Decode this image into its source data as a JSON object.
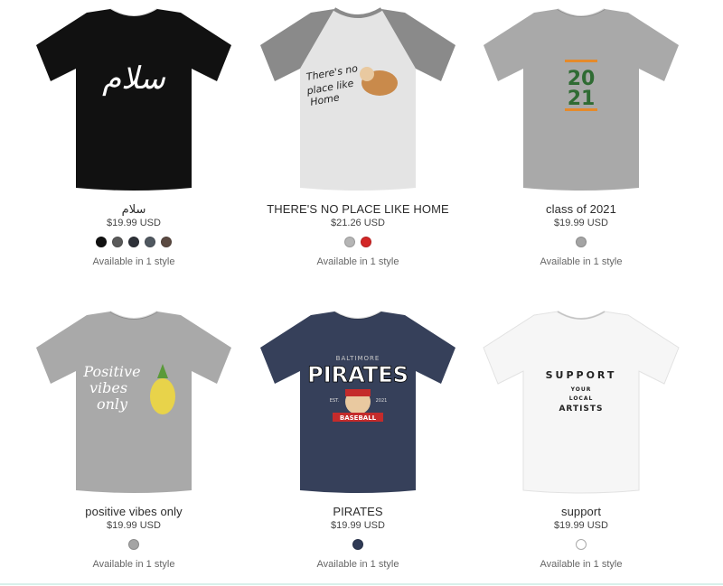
{
  "products": [
    {
      "title": "سلام",
      "price": "$19.99 USD",
      "availability": "Available in 1 style",
      "shirt_color": "#111111",
      "sleeve_color": "#111111",
      "swatches": [
        "#111111",
        "#5a5a5a",
        "#2e3138",
        "#505860",
        "#5b4a42"
      ],
      "print_text": [
        "سلام"
      ],
      "print_color": "#ffffff"
    },
    {
      "title": "THERE'S NO PLACE LIKE HOME",
      "price": "$21.26 USD",
      "availability": "Available in 1 style",
      "shirt_color": "#e4e4e4",
      "sleeve_color": "#8a8a8a",
      "swatches": [
        "#b5b5b5",
        "#d32626"
      ],
      "print_text": [
        "There's no",
        "place like",
        "Home"
      ],
      "print_color": "#222222"
    },
    {
      "title": "class of 2021",
      "price": "$19.99 USD",
      "availability": "Available in 1 style",
      "shirt_color": "#a9a9a9",
      "sleeve_color": "#a9a9a9",
      "swatches": [
        "#a4a4a4"
      ],
      "print_text": [
        "20",
        "21"
      ],
      "print_color": "#2f6b33"
    },
    {
      "title": "positive vibes only",
      "price": "$19.99 USD",
      "availability": "Available in 1 style",
      "shirt_color": "#a9a9a9",
      "sleeve_color": "#a9a9a9",
      "swatches": [
        "#a4a4a4"
      ],
      "print_text": [
        "Positive",
        "vibes",
        "only"
      ],
      "print_color": "#ffffff"
    },
    {
      "title": "PIRATES",
      "price": "$19.99 USD",
      "availability": "Available in 1 style",
      "shirt_color": "#36405a",
      "sleeve_color": "#36405a",
      "swatches": [
        "#2f3a55"
      ],
      "print_text": [
        "BALTIMORE",
        "PIRATES",
        "EST.",
        "2021",
        "BASEBALL"
      ],
      "print_color": "#ffffff"
    },
    {
      "title": "support",
      "price": "$19.99 USD",
      "availability": "Available in 1 style",
      "shirt_color": "#f6f6f6",
      "sleeve_color": "#f6f6f6",
      "swatches": [
        "#ffffff"
      ],
      "print_text": [
        "SUPPORT",
        "YOUR",
        "LOCAL",
        "ARTISTS"
      ],
      "print_color": "#222222"
    }
  ]
}
